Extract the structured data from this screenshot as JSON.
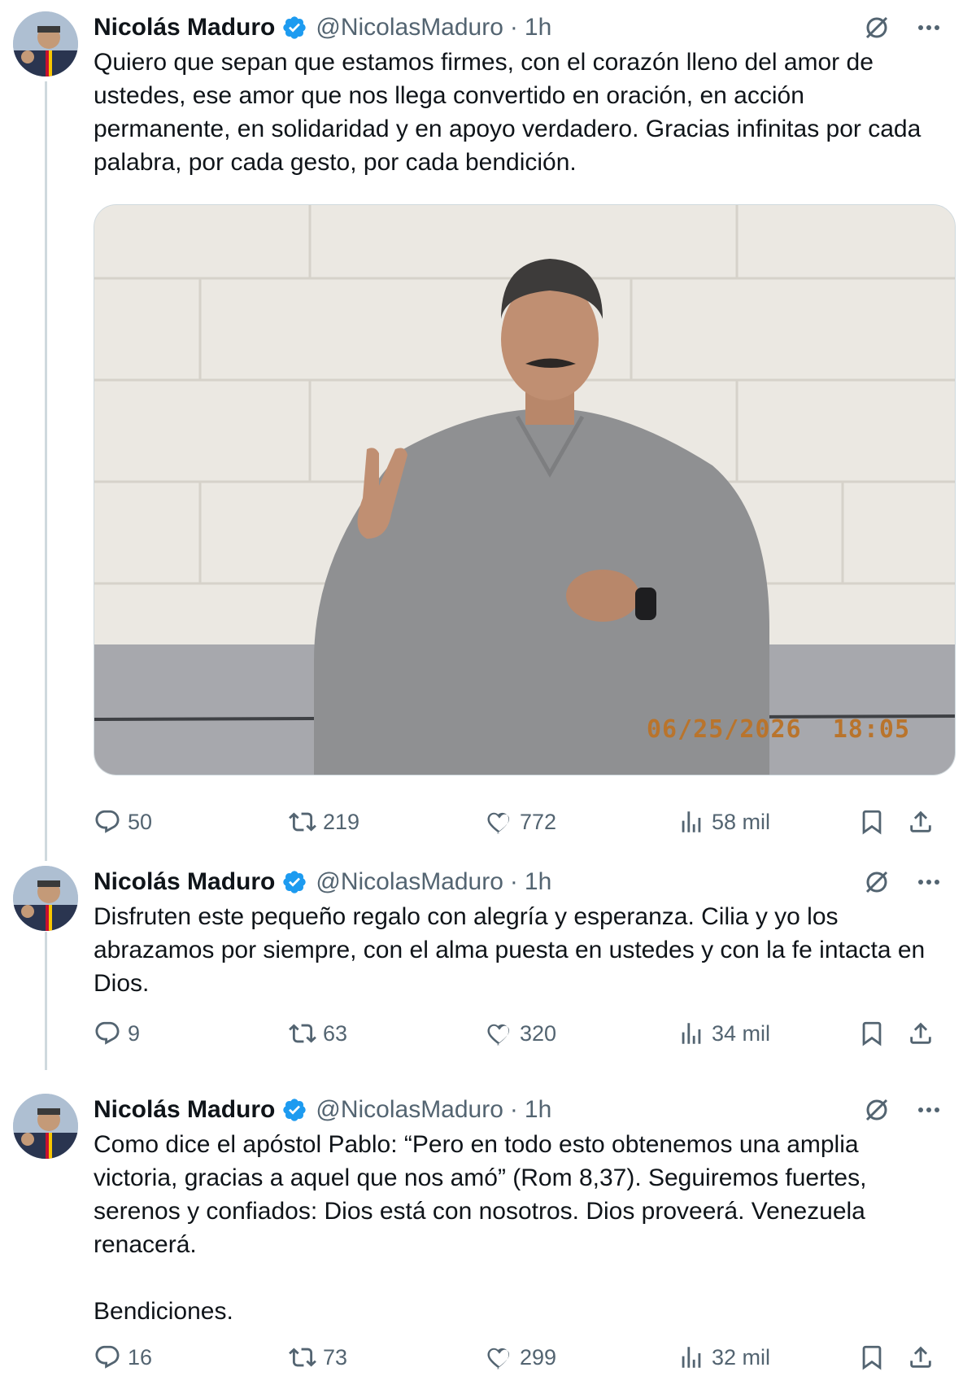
{
  "author": {
    "name": "Nicolás Maduro",
    "handle": "@NicolasMaduro",
    "separator": "·",
    "time": "1h"
  },
  "tweets": [
    {
      "text": "Quiero que sepan que estamos firmes, con el corazón lleno del amor de ustedes, ese amor que nos llega convertido en oración, en acción permanente, en solidaridad y en apoyo verdadero. Gracias infinitas por cada palabra, por cada gesto, por cada bendición.",
      "media": {
        "timestamp_overlay": "06/25/2026  18:05"
      },
      "stats": {
        "replies": "50",
        "reposts": "219",
        "likes": "772",
        "views": "58 mil"
      }
    },
    {
      "text": "Disfruten este pequeño regalo con alegría y esperanza. Cilia y yo los abrazamos por siempre, con el alma puesta en ustedes y con la fe intacta en Dios.",
      "stats": {
        "replies": "9",
        "reposts": "63",
        "likes": "320",
        "views": "34 mil"
      }
    },
    {
      "text": "Como dice el apóstol Pablo: “Pero en todo esto obtenemos una amplia victoria, gracias a aquel que nos amó” (Rom 8,37). Seguiremos fuertes, serenos y confiados: Dios está con nosotros. Dios proveerá. Venezuela renacerá.\n\nBendiciones.",
      "stats": {
        "replies": "16",
        "reposts": "73",
        "likes": "299",
        "views": "32 mil"
      }
    }
  ],
  "colors": {
    "verified": "#1d9bf0",
    "muted": "#536471",
    "text": "#0f1419",
    "thread_line": "#cfd9de"
  },
  "icons": [
    "verified-badge-icon",
    "grok-icon",
    "more-icon",
    "reply-icon",
    "repost-icon",
    "like-icon",
    "views-icon",
    "bookmark-icon",
    "share-icon"
  ]
}
